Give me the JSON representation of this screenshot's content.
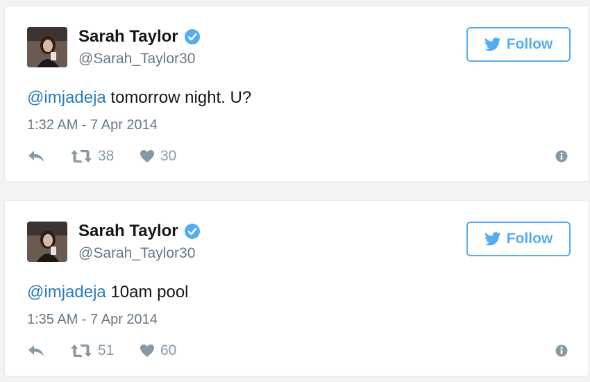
{
  "tweets": [
    {
      "name": "Sarah Taylor",
      "handle": "@Sarah_Taylor30",
      "follow_label": "Follow",
      "mention": "@imjadeja",
      "text": " tomorrow night. U?",
      "timestamp": "1:32 AM - 7 Apr 2014",
      "retweets": "38",
      "likes": "30"
    },
    {
      "name": "Sarah Taylor",
      "handle": "@Sarah_Taylor30",
      "follow_label": "Follow",
      "mention": "@imjadeja",
      "text": " 10am pool",
      "timestamp": "1:35 AM - 7 Apr 2014",
      "retweets": "51",
      "likes": "60"
    }
  ],
  "colors": {
    "accent": "#55acee",
    "mention": "#2b7bb9",
    "muted": "#8899a6"
  },
  "icons": [
    "avatar",
    "verified-badge-icon",
    "twitter-bird-icon",
    "reply-icon",
    "retweet-icon",
    "heart-icon",
    "info-icon"
  ]
}
